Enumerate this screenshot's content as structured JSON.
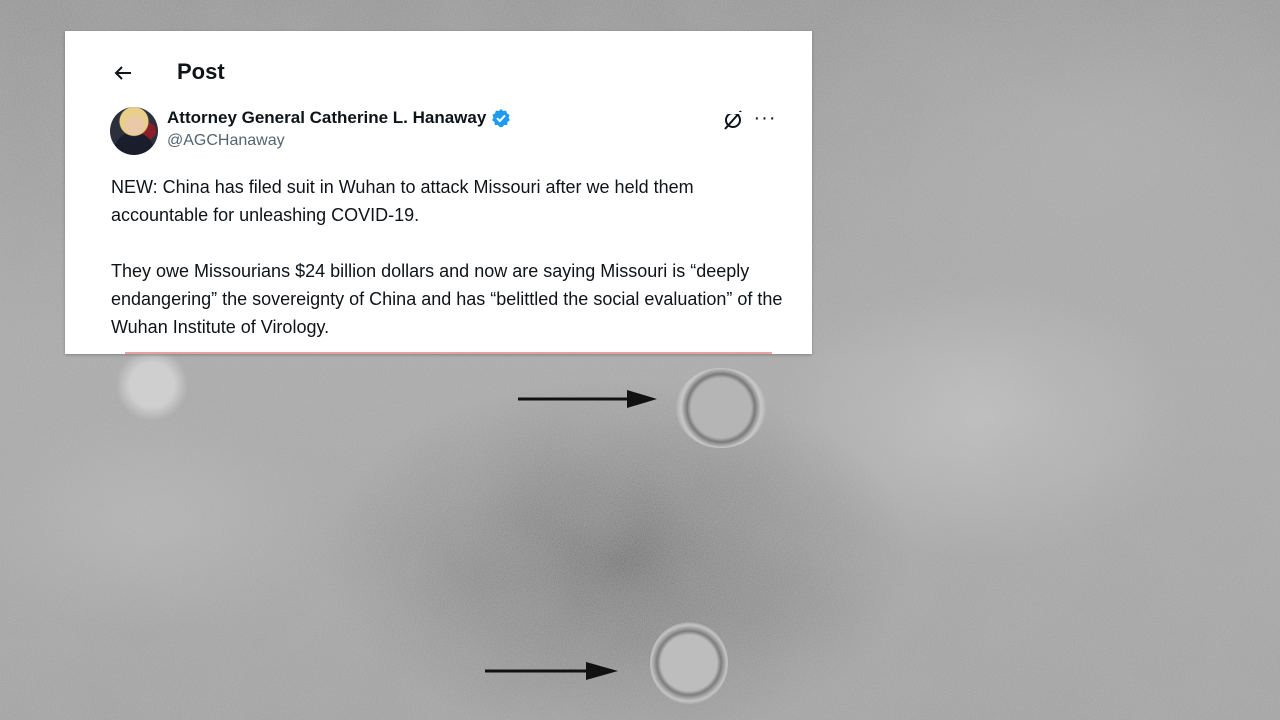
{
  "post": {
    "header_title": "Post",
    "author_name": "Attorney General Catherine L. Hanaway",
    "author_handle": "@AGCHanaway",
    "paragraph1": "NEW: China has filed suit in Wuhan to attack Missouri after we held them accountable for unleashing COVID-19.",
    "paragraph2": "They owe Missourians $24 billion dollars and now are saying Missouri is “deeply endangering” the sovereignty of China and has “belittled the social evaluation” of the Wuhan Institute of Virology."
  },
  "icons": {
    "back": "back-arrow-icon",
    "verified": "verified-badge-icon",
    "grok": "grok-icon",
    "more": "more-icon"
  },
  "colors": {
    "verified_blue": "#1d9bf0",
    "text_primary": "#0f1419",
    "text_secondary": "#536471"
  }
}
